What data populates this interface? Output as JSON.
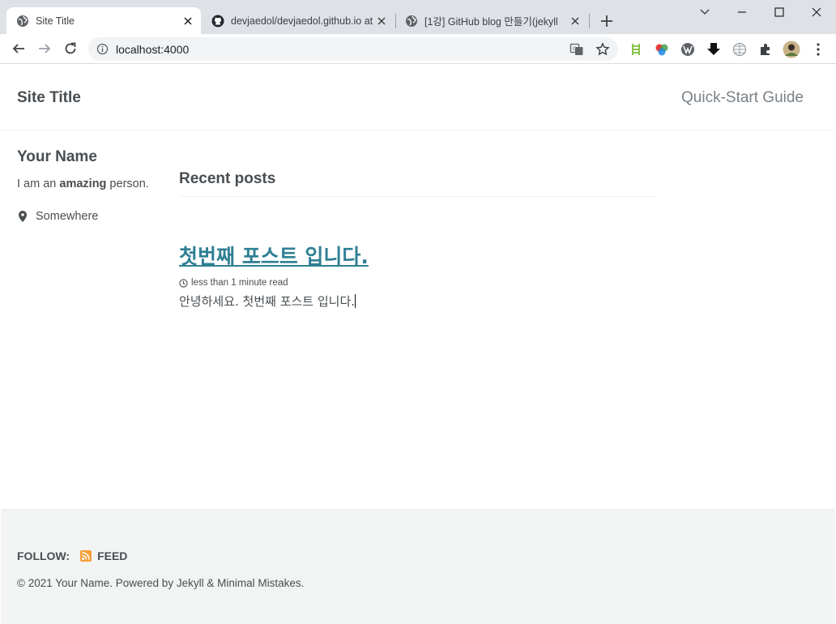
{
  "browser": {
    "tabs": [
      {
        "title": "Site Title",
        "icon": "globe-icon",
        "active": true
      },
      {
        "title": "devjaedol/devjaedol.github.io at",
        "icon": "github-icon",
        "active": false
      },
      {
        "title": "[1강] GitHub blog 만들기(jekyll",
        "icon": "globe-icon",
        "active": false
      }
    ],
    "url": "localhost:4000"
  },
  "masthead": {
    "site_title": "Site Title",
    "nav": [
      "Quick-Start Guide"
    ]
  },
  "author": {
    "name": "Your Name",
    "bio_prefix": "I am an ",
    "bio_bold": "amazing",
    "bio_suffix": " person.",
    "location": "Somewhere"
  },
  "main": {
    "section_title": "Recent posts",
    "posts": [
      {
        "title": "첫번째 포스트 입니다.",
        "read_time": "less than 1 minute read",
        "excerpt": "안녕하세요. 첫번째 포스트 입니다."
      }
    ]
  },
  "footer": {
    "follow_label": "FOLLOW:",
    "feed_label": "FEED",
    "copyright": "© 2021 Your Name. Powered by Jekyll & Minimal Mistakes."
  },
  "colors": {
    "link": "#2f7f93",
    "text": "#494e52",
    "footer_bg": "#f2f3f3",
    "feed": "#f89f37"
  }
}
